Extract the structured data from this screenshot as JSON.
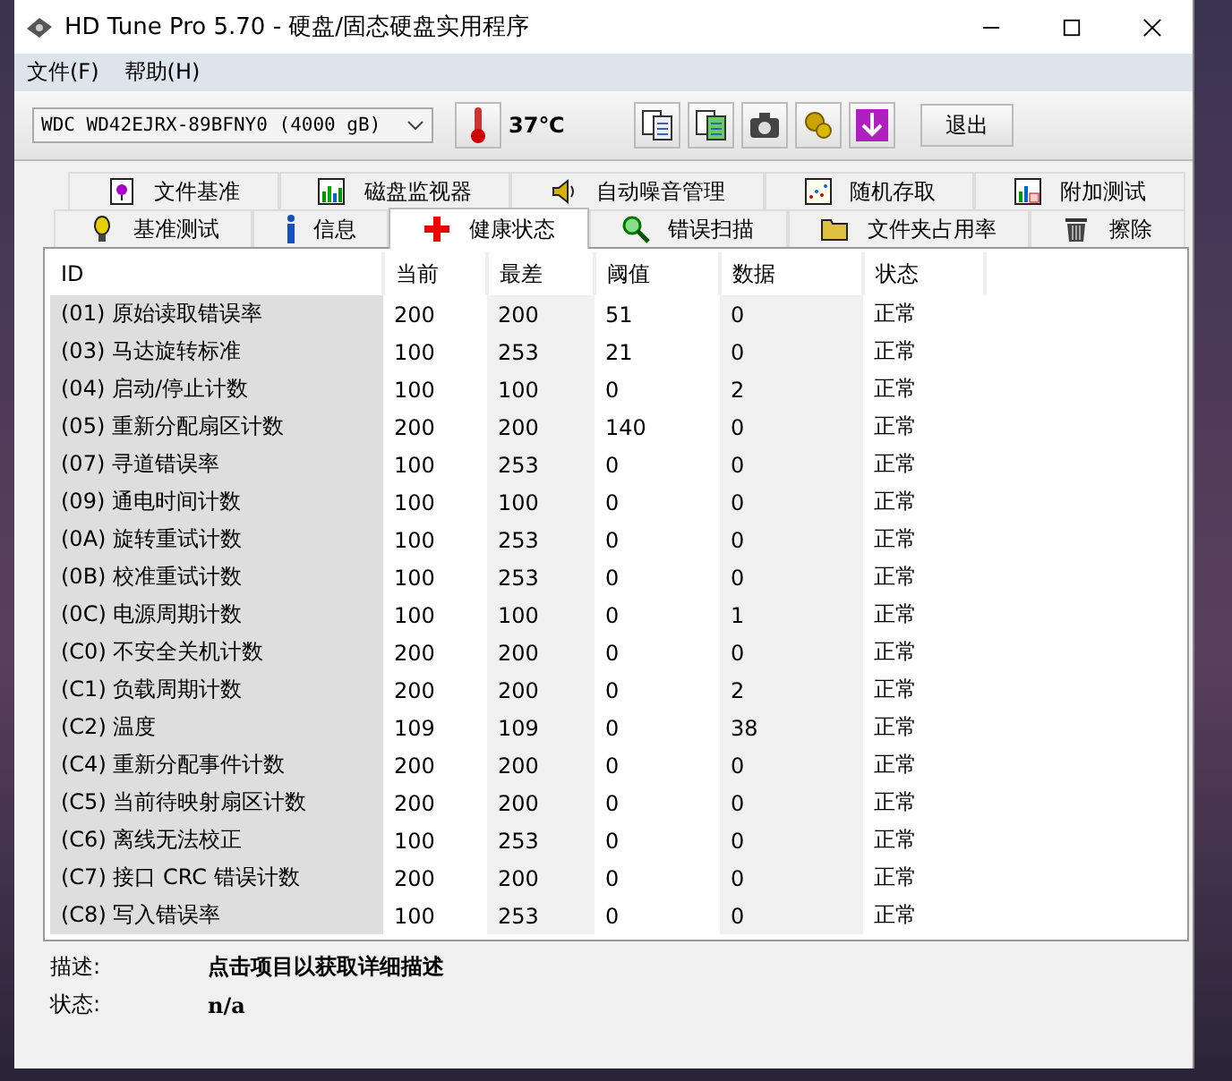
{
  "window": {
    "title": "HD Tune Pro 5.70 - 硬盘/固态硬盘实用程序"
  },
  "menu": [
    "文件(F)",
    "帮助(H)"
  ],
  "toolbar": {
    "drive": "WDC WD42EJRX-89BFNY0 (4000 gB)",
    "temperature": "37℃",
    "exit_button": "退出"
  },
  "tab_rows": [
    [
      {
        "label": "文件基准",
        "selected": false
      },
      {
        "label": "磁盘监视器",
        "selected": false
      },
      {
        "label": "自动噪音管理",
        "selected": false
      },
      {
        "label": "随机存取",
        "selected": false
      },
      {
        "label": "附加测试",
        "selected": false
      }
    ],
    [
      {
        "label": "基准测试",
        "selected": false
      },
      {
        "label": "信息",
        "selected": false
      },
      {
        "label": "健康状态",
        "selected": true
      },
      {
        "label": "错误扫描",
        "selected": false
      },
      {
        "label": "文件夹占用率",
        "selected": false
      },
      {
        "label": "擦除",
        "selected": false
      }
    ]
  ],
  "table": {
    "columns": [
      "ID",
      "当前",
      "最差",
      "阈值",
      "数据",
      "状态"
    ],
    "rows": [
      [
        "(01) 原始读取错误率",
        "200",
        "200",
        "51",
        "0",
        "正常"
      ],
      [
        "(03) 马达旋转标准",
        "100",
        "253",
        "21",
        "0",
        "正常"
      ],
      [
        "(04) 启动/停止计数",
        "100",
        "100",
        "0",
        "2",
        "正常"
      ],
      [
        "(05) 重新分配扇区计数",
        "200",
        "200",
        "140",
        "0",
        "正常"
      ],
      [
        "(07) 寻道错误率",
        "100",
        "253",
        "0",
        "0",
        "正常"
      ],
      [
        "(09) 通电时间计数",
        "100",
        "100",
        "0",
        "0",
        "正常"
      ],
      [
        "(0A) 旋转重试计数",
        "100",
        "253",
        "0",
        "0",
        "正常"
      ],
      [
        "(0B) 校准重试计数",
        "100",
        "253",
        "0",
        "0",
        "正常"
      ],
      [
        "(0C) 电源周期计数",
        "100",
        "100",
        "0",
        "1",
        "正常"
      ],
      [
        "(C0) 不安全关机计数",
        "200",
        "200",
        "0",
        "0",
        "正常"
      ],
      [
        "(C1) 负载周期计数",
        "200",
        "200",
        "0",
        "2",
        "正常"
      ],
      [
        "(C2) 温度",
        "109",
        "109",
        "0",
        "38",
        "正常"
      ],
      [
        "(C4) 重新分配事件计数",
        "200",
        "200",
        "0",
        "0",
        "正常"
      ],
      [
        "(C5) 当前待映射扇区计数",
        "200",
        "200",
        "0",
        "0",
        "正常"
      ],
      [
        "(C6) 离线无法校正",
        "100",
        "253",
        "0",
        "0",
        "正常"
      ],
      [
        "(C7) 接口 CRC 错误计数",
        "200",
        "200",
        "0",
        "0",
        "正常"
      ],
      [
        "(C8) 写入错误率",
        "100",
        "253",
        "0",
        "0",
        "正常"
      ]
    ]
  },
  "details": [
    {
      "label": "描述:",
      "value": "点击项目以获取详细描述"
    },
    {
      "label": "状态:",
      "value": "n/a"
    }
  ]
}
